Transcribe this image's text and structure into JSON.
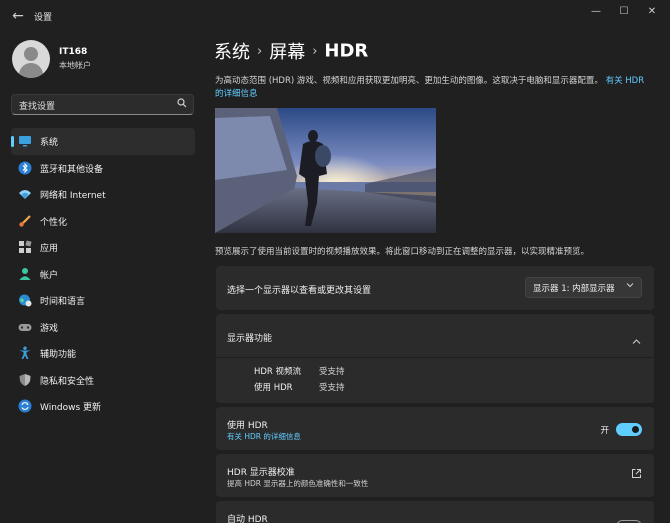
{
  "window": {
    "title": "设置",
    "back_glyph": "←",
    "minimize_glyph": "—",
    "maximize_glyph": "☐",
    "close_glyph": "✕"
  },
  "profile": {
    "name": "IT168",
    "account_type": "本地帐户"
  },
  "search": {
    "placeholder": "查找设置",
    "icon": "search-icon"
  },
  "sidebar": {
    "items": [
      {
        "label": "系统",
        "icon": "monitor-icon",
        "active": true
      },
      {
        "label": "蓝牙和其他设备",
        "icon": "bluetooth-icon",
        "active": false
      },
      {
        "label": "网络和 Internet",
        "icon": "wifi-icon",
        "active": false
      },
      {
        "label": "个性化",
        "icon": "brush-icon",
        "active": false
      },
      {
        "label": "应用",
        "icon": "apps-icon",
        "active": false
      },
      {
        "label": "帐户",
        "icon": "person-icon",
        "active": false
      },
      {
        "label": "时间和语言",
        "icon": "globe-clock-icon",
        "active": false
      },
      {
        "label": "游戏",
        "icon": "gamepad-icon",
        "active": false
      },
      {
        "label": "辅助功能",
        "icon": "accessibility-icon",
        "active": false
      },
      {
        "label": "隐私和安全性",
        "icon": "shield-icon",
        "active": false
      },
      {
        "label": "Windows 更新",
        "icon": "update-icon",
        "active": false
      }
    ]
  },
  "breadcrumb": {
    "level1": "系统",
    "level2": "屏幕",
    "current": "HDR",
    "separator": "›"
  },
  "main": {
    "description": "为高动态范围 (HDR) 游戏、视频和应用获取更加明亮、更加生动的图像。这取决于电脑和显示器配置。",
    "description_link": "有关 HDR 的详细信息",
    "preview_caption": "预览展示了使用当前设置时的视频播放效果。将此窗口移动到正在调整的显示器，以实现精准预览。",
    "display_select": {
      "label": "选择一个显示器以查看或更改其设置",
      "value": "显示器 1: 内部显示器"
    },
    "display_features": {
      "title": "显示器功能",
      "rows": [
        {
          "key": "HDR 视频流",
          "value": "受支持"
        },
        {
          "key": "使用 HDR",
          "value": "受支持"
        }
      ]
    },
    "use_hdr": {
      "title": "使用 HDR",
      "link": "有关 HDR 的详细信息",
      "state_label": "开",
      "on": true
    },
    "calibration": {
      "title": "HDR 显示器校准",
      "subtitle": "提高 HDR 显示器上的颜色准确性和一致性"
    },
    "auto_hdr": {
      "title": "自动 HDR"
    }
  },
  "colors": {
    "accent": "#60cdff",
    "background": "#202020",
    "card": "#2b2b2b"
  }
}
